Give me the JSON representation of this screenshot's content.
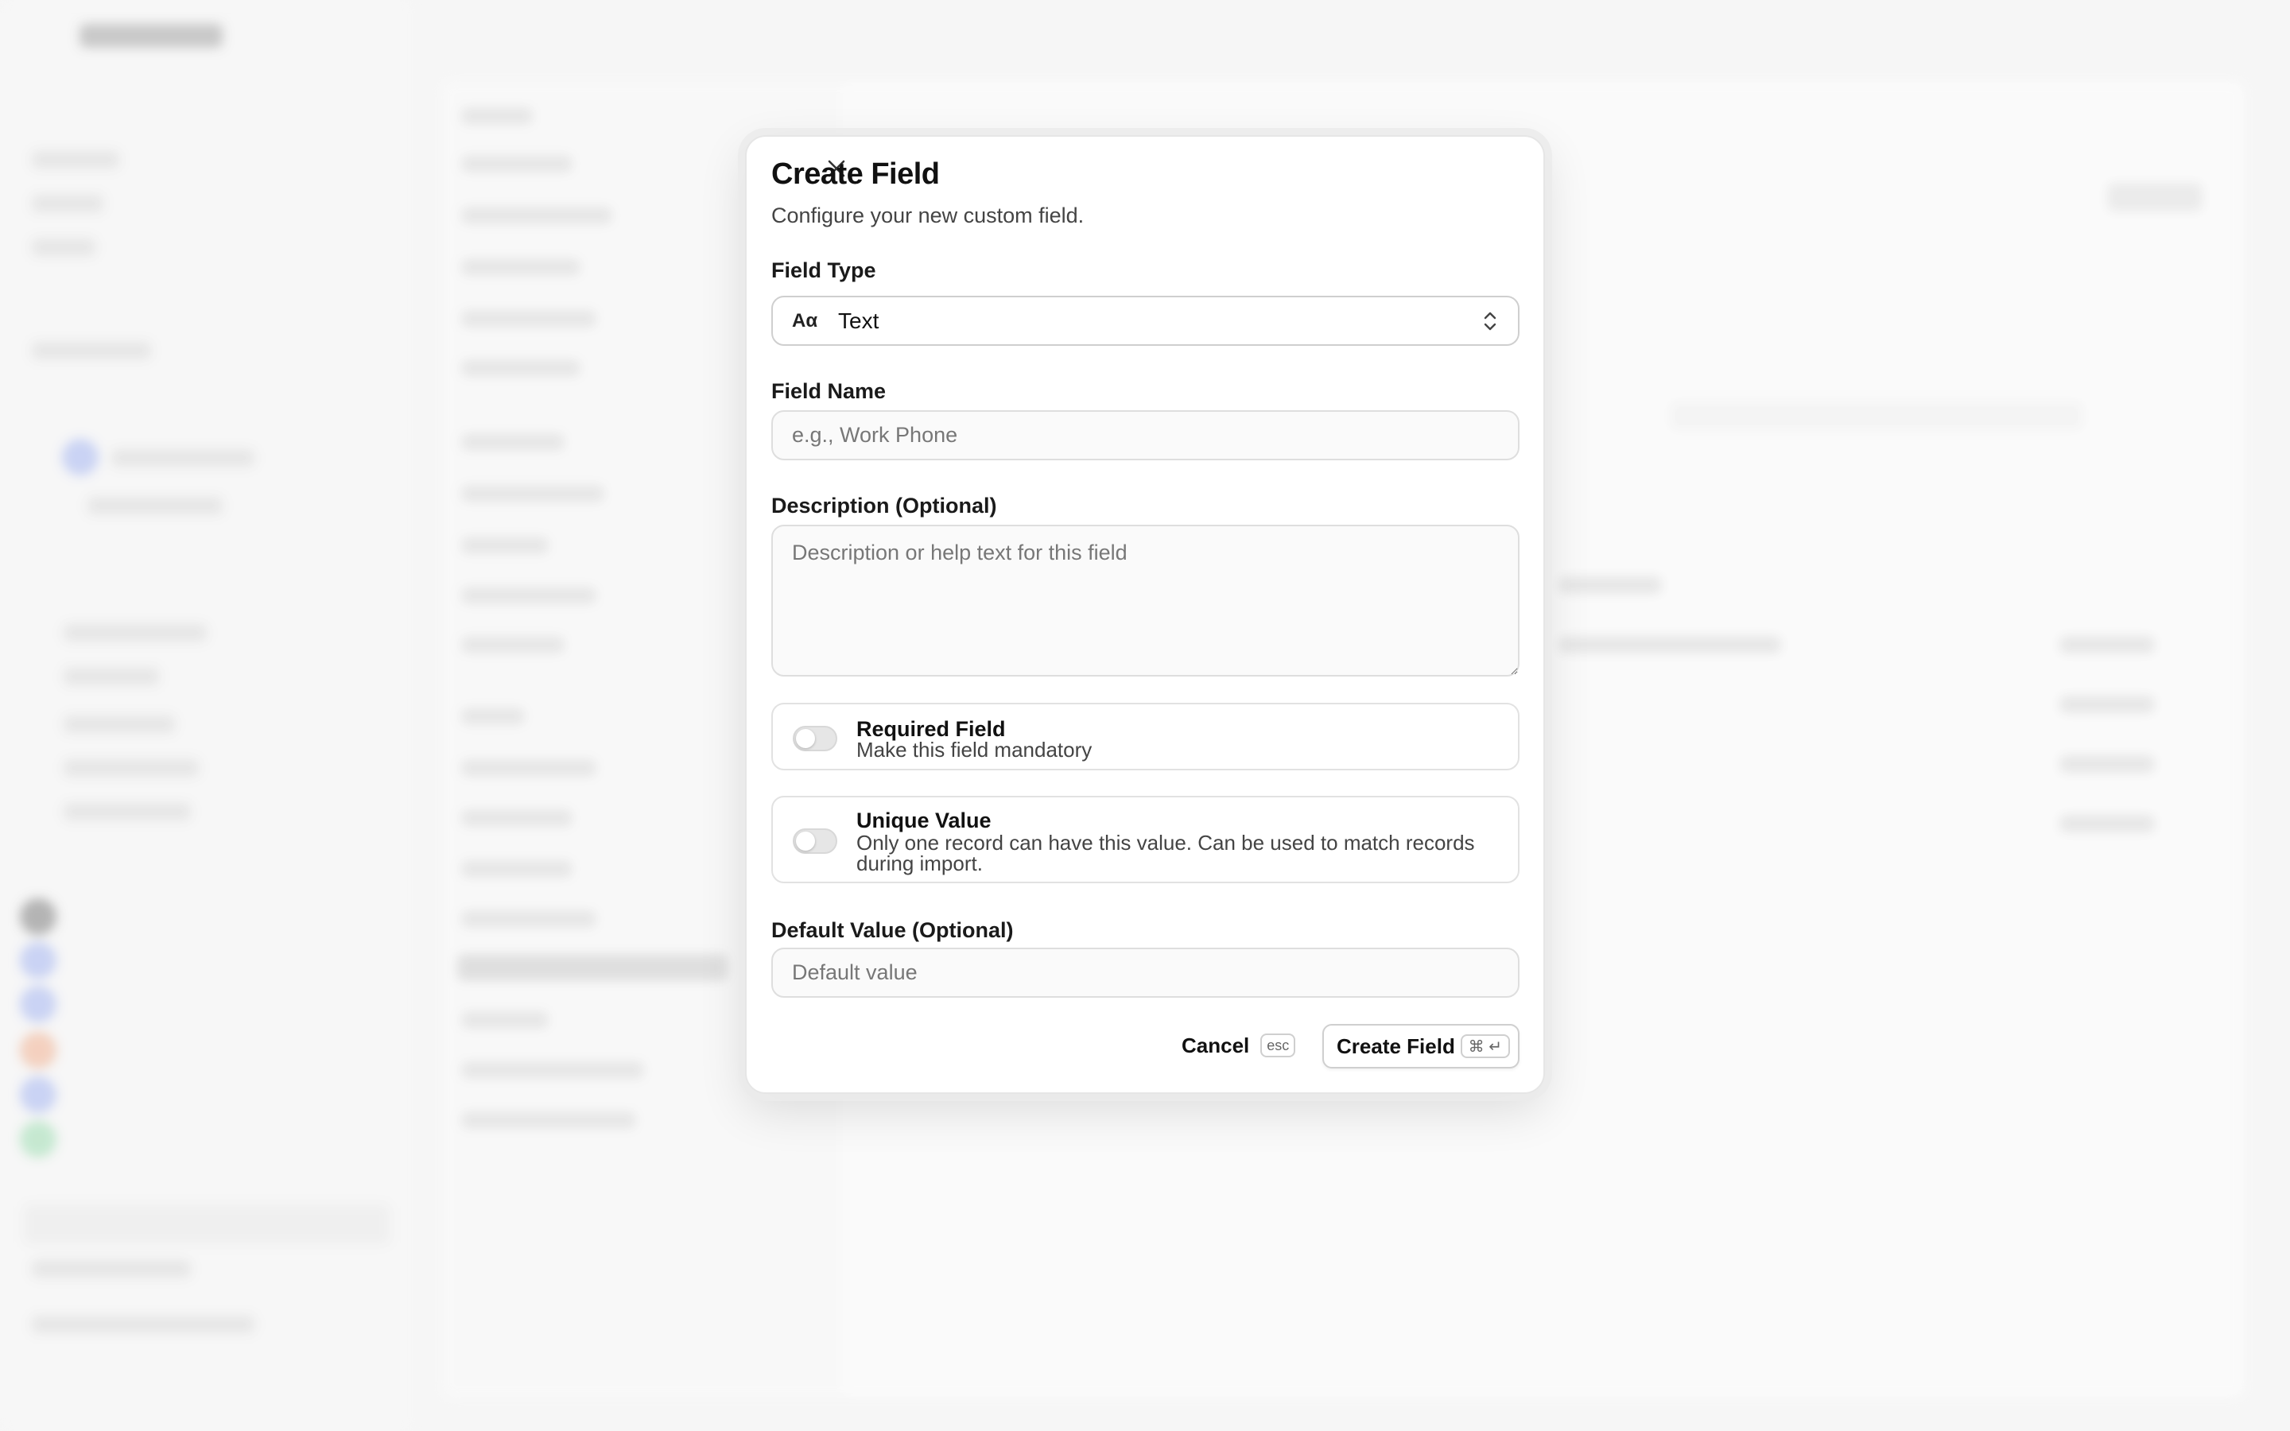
{
  "dialog": {
    "title": "Create Field",
    "subtitle": "Configure your new custom field.",
    "field_type": {
      "label": "Field Type",
      "selected_icon_glyph": "Aα",
      "selected_icon": "text-type-icon",
      "selected_value": "Text"
    },
    "field_name": {
      "label": "Field Name",
      "value": "",
      "placeholder": "e.g., Work Phone"
    },
    "description": {
      "label": "Description (Optional)",
      "value": "",
      "placeholder": "Description or help text for this field"
    },
    "required": {
      "title": "Required Field",
      "description": "Make this field mandatory",
      "enabled": false
    },
    "unique": {
      "title": "Unique Value",
      "description": "Only one record can have this value. Can be used to match records during import.",
      "enabled": false
    },
    "default_value": {
      "label": "Default Value (Optional)",
      "value": "",
      "placeholder": "Default value"
    },
    "actions": {
      "cancel_label": "Cancel",
      "cancel_shortcut": "esc",
      "create_label": "Create Field",
      "create_shortcut": "⌘ ↵"
    }
  }
}
